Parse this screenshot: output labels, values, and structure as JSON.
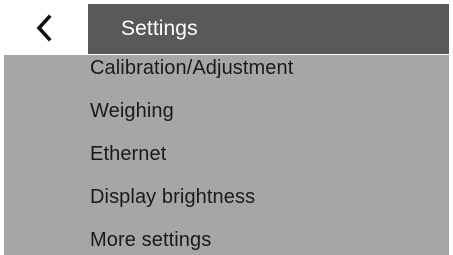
{
  "header": {
    "back_icon": "chevron-left-icon",
    "title": "Settings"
  },
  "menu": {
    "items": [
      {
        "label": "Calibration/Adjustment"
      },
      {
        "label": "Weighing"
      },
      {
        "label": "Ethernet"
      },
      {
        "label": "Display brightness"
      },
      {
        "label": "More settings"
      }
    ]
  },
  "colors": {
    "title_bar": "#595959",
    "menu_background": "#a6a6a6",
    "title_text": "#ffffff",
    "menu_text": "#1a1a1a"
  }
}
